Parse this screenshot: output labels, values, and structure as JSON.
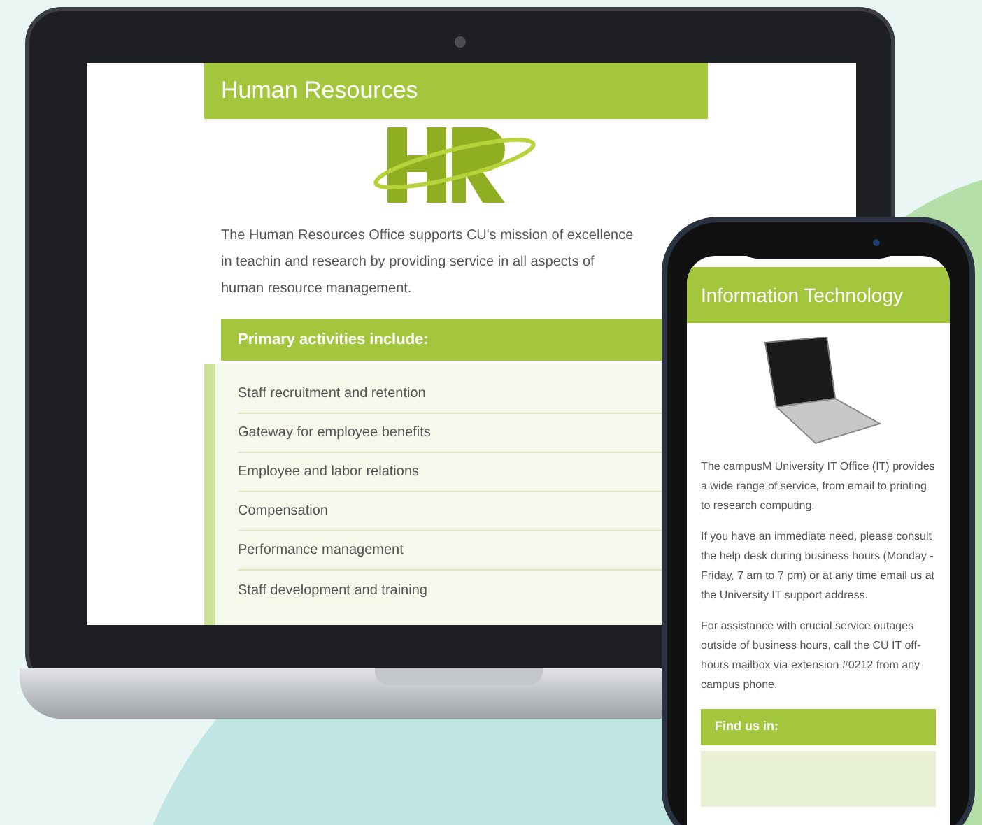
{
  "laptop_page": {
    "title": "Human Resources",
    "intro": "The Human Resources Office supports CU's mission of excellence in teachin and research by providing service in all aspects of human resource management.",
    "section_title": "Primary activities include:",
    "activities": [
      "Staff recruitment and retention",
      "Gateway for employee benefits",
      "Employee and labor relations",
      "Compensation",
      "Performance management",
      "Staff development and training"
    ]
  },
  "phone_page": {
    "title": "Information Technology",
    "paragraphs": [
      "The campusM University IT Office (IT) provides a wide range of service, from email to printing to research computing.",
      "If you have an immediate need, please consult the help desk during business hours (Monday - Friday, 7 am to 7 pm) or at any time email us at the University IT support address.",
      "For assistance with crucial service outages outside of business hours, call the CU IT off-hours mailbox via extension #0212 from any campus phone."
    ],
    "section_title": "Find us in:"
  }
}
